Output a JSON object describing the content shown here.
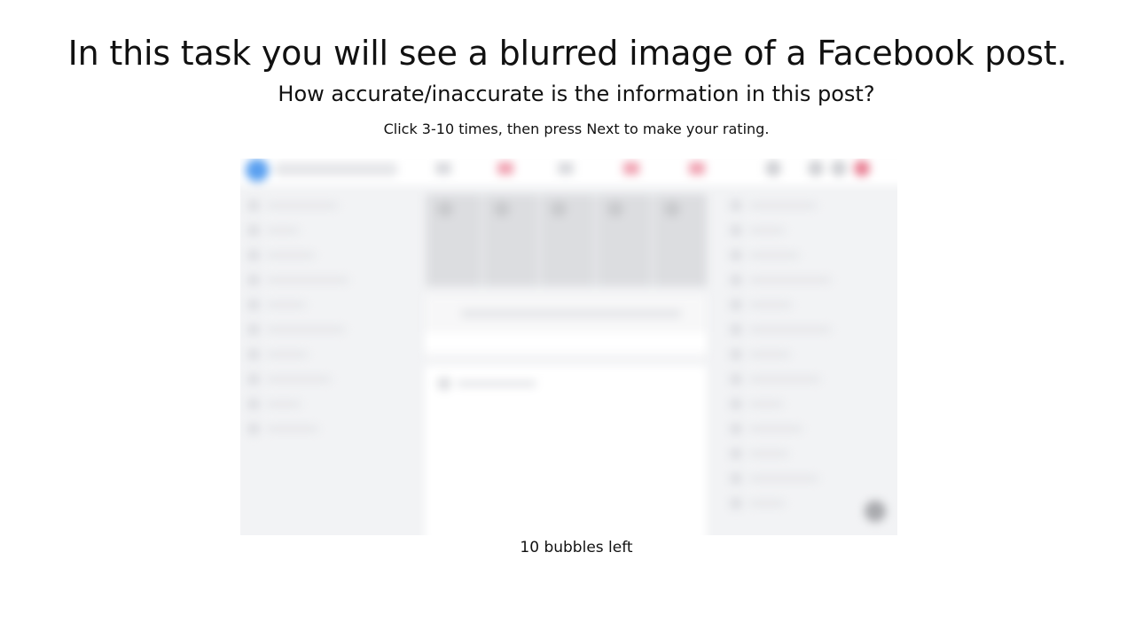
{
  "task": {
    "title": "In this task you will see a blurred image of a Facebook post.",
    "question": "How accurate/inaccurate is the information in this post?",
    "instruction": "Click 3-10 times, then press Next to make your rating.",
    "bubbles_left": "10 bubbles left"
  },
  "post_image": {
    "icon": "blurred-facebook-post-image",
    "colors": {
      "background": "#f2f3f5",
      "logo": "#5aa0f0",
      "notification": "#e87e92"
    }
  }
}
